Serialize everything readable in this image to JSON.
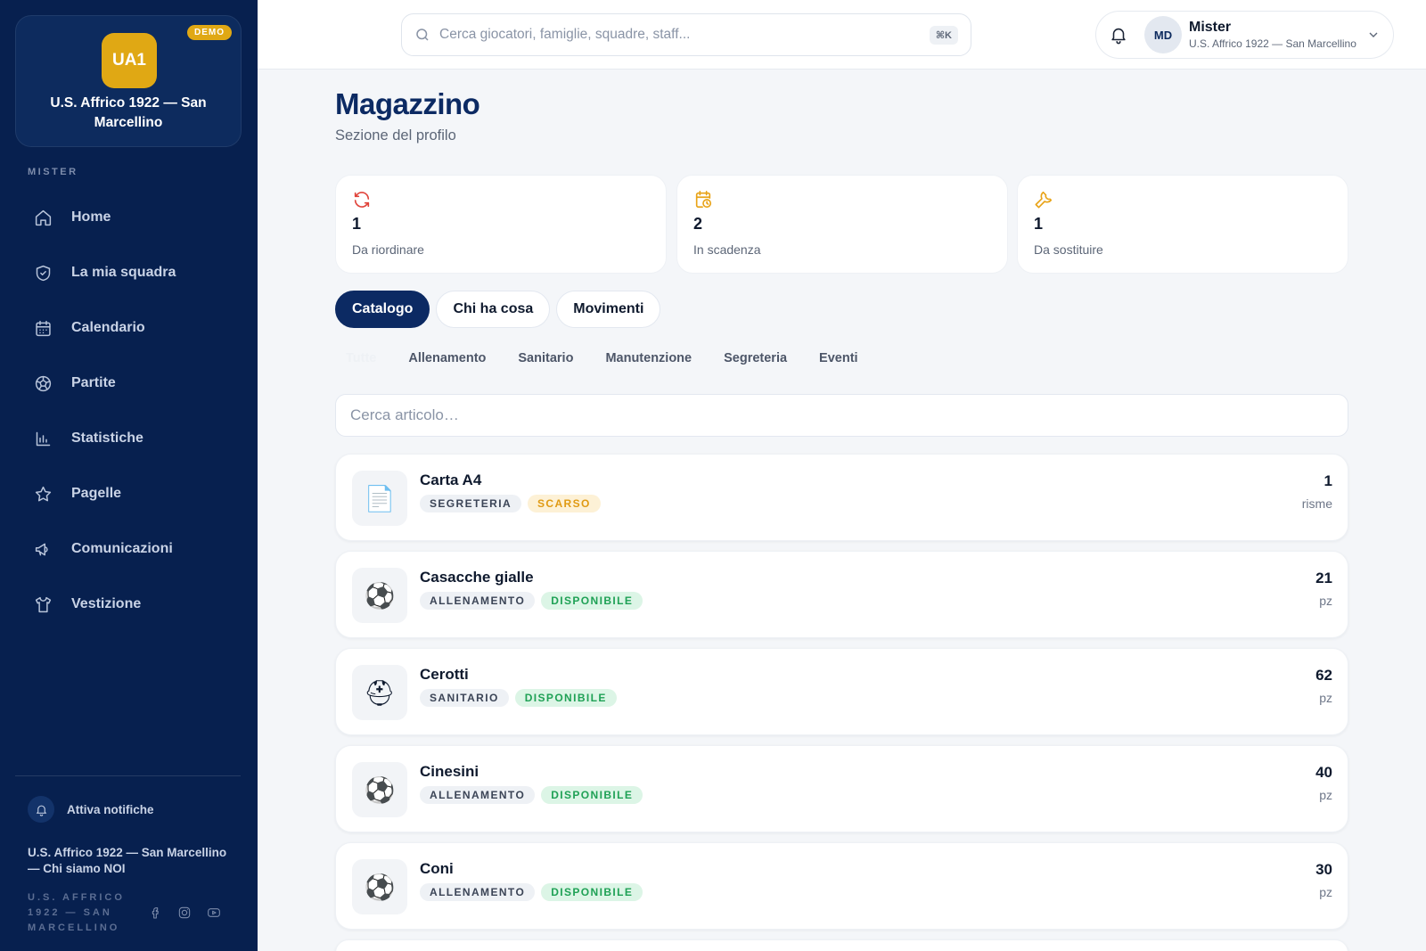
{
  "sidebar": {
    "club_initials": "UA1",
    "demo_badge": "DEMO",
    "club_name": "U.S. Affrico 1922 — San Marcellino",
    "role_label": "MISTER",
    "nav": [
      {
        "label": "Home",
        "icon": "home-icon"
      },
      {
        "label": "La mia squadra",
        "icon": "shield-icon"
      },
      {
        "label": "Calendario",
        "icon": "calendar-icon"
      },
      {
        "label": "Partite",
        "icon": "ball-icon"
      },
      {
        "label": "Statistiche",
        "icon": "bar-chart-icon"
      },
      {
        "label": "Pagelle",
        "icon": "star-icon"
      },
      {
        "label": "Comunicazioni",
        "icon": "megaphone-icon"
      },
      {
        "label": "Vestizione",
        "icon": "shirt-icon"
      }
    ],
    "notifications_label": "Attiva notifiche",
    "about_link": "U.S. Affrico 1922 — San Marcellino — Chi siamo NOI",
    "footer_brand": "U.S. AFFRICO 1922 — SAN MARCELLINO",
    "socials": [
      "facebook-icon",
      "instagram-icon",
      "youtube-icon"
    ]
  },
  "topbar": {
    "search_placeholder": "Cerca giocatori, famiglie, squadre, staff...",
    "shortcut": "⌘K",
    "user": {
      "initials": "MD",
      "name": "Mister",
      "club": "U.S. Affrico 1922 — San Marcellino"
    }
  },
  "page": {
    "title": "Magazzino",
    "subtitle": "Sezione del profilo"
  },
  "stats": [
    {
      "value": "1",
      "label": "Da riordinare",
      "icon": "refresh-icon",
      "color": "#e0433a"
    },
    {
      "value": "2",
      "label": "In scadenza",
      "icon": "calendar-clock-icon",
      "color": "#e8a317"
    },
    {
      "value": "1",
      "label": "Da sostituire",
      "icon": "wrench-icon",
      "color": "#e8a317"
    }
  ],
  "tabs": [
    {
      "label": "Catalogo",
      "active": true
    },
    {
      "label": "Chi ha cosa",
      "active": false
    },
    {
      "label": "Movimenti",
      "active": false
    }
  ],
  "filters": [
    "Tutte",
    "Allenamento",
    "Sanitario",
    "Manutenzione",
    "Segreteria",
    "Eventi"
  ],
  "item_search_placeholder": "Cerca articolo…",
  "items": [
    {
      "name": "Carta A4",
      "category": "SEGRETERIA",
      "status": "SCARSO",
      "status_type": "low",
      "qty": "1",
      "unit": "risme",
      "icon": "📄"
    },
    {
      "name": "Casacche gialle",
      "category": "ALLENAMENTO",
      "status": "DISPONIBILE",
      "status_type": "ok",
      "qty": "21",
      "unit": "pz",
      "icon": "⚽"
    },
    {
      "name": "Cerotti",
      "category": "SANITARIO",
      "status": "DISPONIBILE",
      "status_type": "ok",
      "qty": "62",
      "unit": "pz",
      "icon": "⛑"
    },
    {
      "name": "Cinesini",
      "category": "ALLENAMENTO",
      "status": "DISPONIBILE",
      "status_type": "ok",
      "qty": "40",
      "unit": "pz",
      "icon": "⚽"
    },
    {
      "name": "Coni",
      "category": "ALLENAMENTO",
      "status": "DISPONIBILE",
      "status_type": "ok",
      "qty": "30",
      "unit": "pz",
      "icon": "⚽"
    }
  ]
}
